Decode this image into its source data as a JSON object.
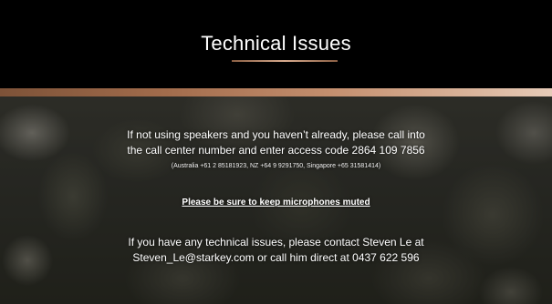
{
  "slide": {
    "title": "Technical Issues",
    "call_line_1": "If not using speakers and you haven’t already, please call into",
    "call_line_2": "the call center number and enter access code 2864 109 7856",
    "dial_in_numbers": "(Australia +61 2 85181923, NZ +64 9 9291750, Singapore +65 31581414)",
    "mute_notice": "Please be sure to keep microphones muted",
    "contact_line_1": "If you have any technical issues, please contact Steven Le at",
    "contact_line_2": "Steven_Le@starkey.com or call him direct at 0437 622 596"
  }
}
